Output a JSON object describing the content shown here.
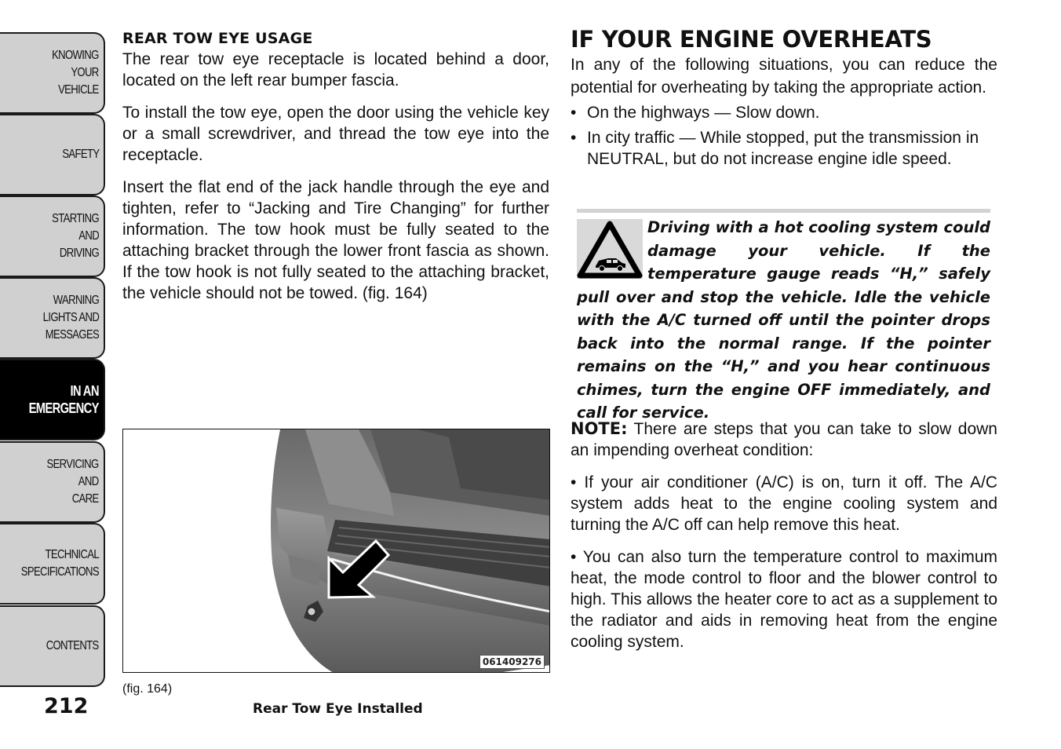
{
  "side_tabs": [
    {
      "label": "KNOWING\nYOUR\nVEHICLE",
      "active": false
    },
    {
      "label": "SAFETY",
      "active": false
    },
    {
      "label": "STARTING\nAND\nDRIVING",
      "active": false
    },
    {
      "label": "WARNING\nLIGHTS AND\nMESSAGES",
      "active": false
    },
    {
      "label": "IN AN\nEMERGENCY",
      "active": true
    },
    {
      "label": "SERVICING\nAND\nCARE",
      "active": false
    },
    {
      "label": "TECHNICAL\nSPECIFICATIONS",
      "active": false
    },
    {
      "label": "CONTENTS",
      "active": false
    }
  ],
  "page_number": "212",
  "left": {
    "heading": "REAR TOW EYE USAGE",
    "paragraphs": [
      "The rear tow eye receptacle is located behind a door, located on the left rear bumper fascia.",
      "To install the tow eye, open the door using the vehicle key or a small screwdriver, and thread the tow eye into the receptacle.",
      "Insert the flat end of the jack handle through the eye and tighten, refer to “Jacking and Tire Changing” for further information. The tow hook must be fully seated to the attaching bracket through the lower front fascia as shown. If the tow hook is not fully seated to the attaching bracket, the vehicle should not be towed. (fig.  164)"
    ],
    "figure": {
      "id_label": "061409276",
      "ref": "(fig. 164)",
      "caption": "Rear Tow Eye Installed"
    }
  },
  "right": {
    "heading": "IF YOUR ENGINE OVERHEATS",
    "intro": "In any of the following situations, you can reduce the potential for overheating by taking the appropriate action.",
    "bullets": [
      "On the highways — Slow down.",
      "In city traffic — While stopped, put the transmission in NEUTRAL, but do not increase engine idle speed."
    ],
    "warning": {
      "icon": "warning-triangle-car-icon",
      "text": "Driving with a hot cooling system could damage your vehicle. If the temperature gauge reads “H,” safely pull over and stop the vehicle. Idle the vehicle with the A/C turned off until the pointer drops back into the normal range. If the pointer remains on the “H,” and you hear continuous chimes, turn the engine OFF immediately, and call for service."
    },
    "note": {
      "label": "NOTE:",
      "text": " There are steps that you can take to slow down an impending overheat condition:",
      "bullets": [
        "•  If your air conditioner (A/C) is on, turn it off. The A/C system adds heat to the engine cooling system and turning the A/C off can help remove this heat.",
        "•  You can also turn the temperature control to maximum heat, the mode control to floor and the blower control to high. This allows the heater core to act as a supplement to the radiator and aids in removing heat from the engine cooling system."
      ]
    }
  }
}
